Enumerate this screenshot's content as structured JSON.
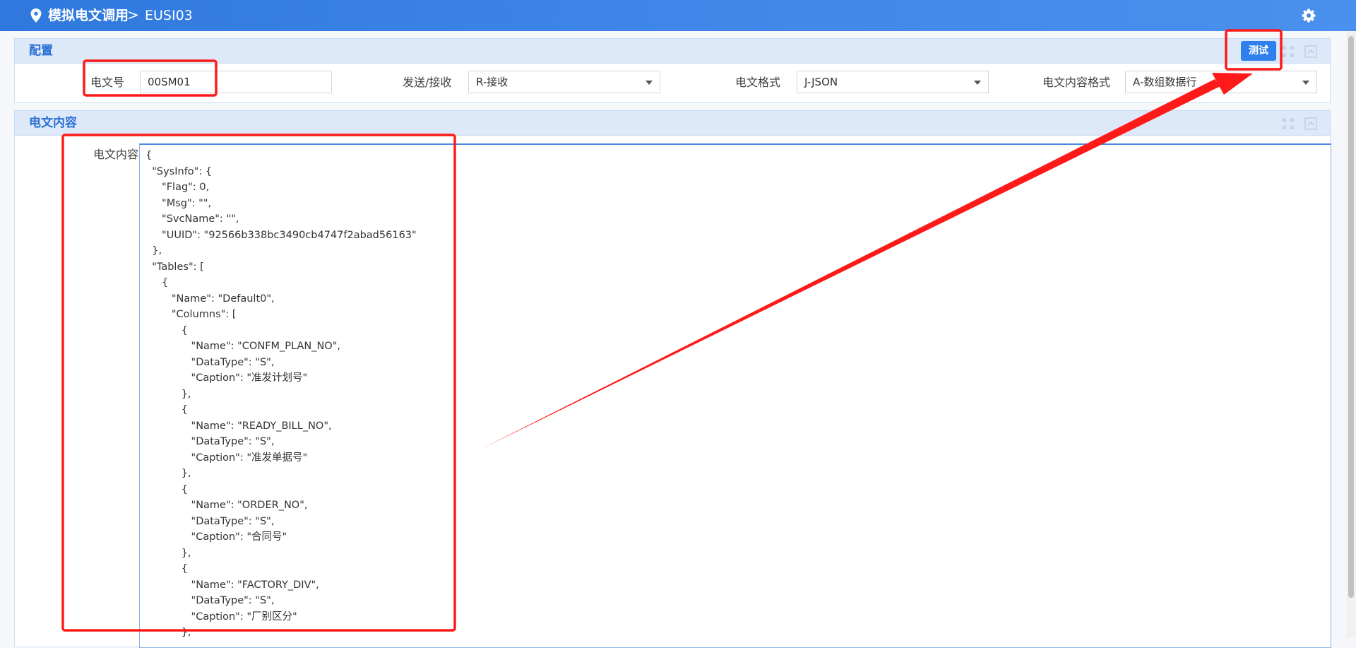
{
  "header": {
    "breadcrumb_module": "模拟电文调用",
    "breadcrumb_separator": ">",
    "breadcrumb_current": "EUSI03"
  },
  "config_panel": {
    "title": "配置",
    "test_button": "测试",
    "fields": {
      "message_no_label": "电文号",
      "message_no_value": "00SM01",
      "direction_label": "发送/接收",
      "direction_value": "R-接收",
      "format_label": "电文格式",
      "format_value": "J-JSON",
      "content_format_label": "电文内容格式",
      "content_format_value": "A-数组数据行"
    }
  },
  "content_panel": {
    "title": "电文内容",
    "field_label": "电文内容",
    "body": "{\n  \"SysInfo\": {\n     \"Flag\": 0,\n     \"Msg\": \"\",\n     \"SvcName\": \"\",\n     \"UUID\": \"92566b338bc3490cb4747f2abad56163\"\n  },\n  \"Tables\": [\n     {\n        \"Name\": \"Default0\",\n        \"Columns\": [\n           {\n              \"Name\": \"CONFM_PLAN_NO\",\n              \"DataType\": \"S\",\n              \"Caption\": \"准发计划号\"\n           },\n           {\n              \"Name\": \"READY_BILL_NO\",\n              \"DataType\": \"S\",\n              \"Caption\": \"准发单据号\"\n           },\n           {\n              \"Name\": \"ORDER_NO\",\n              \"DataType\": \"S\",\n              \"Caption\": \"合同号\"\n           },\n           {\n              \"Name\": \"FACTORY_DIV\",\n              \"DataType\": \"S\",\n              \"Caption\": \"厂别区分\"\n           },"
  },
  "colors": {
    "header_bg": "#3a82e4",
    "panel_head_bg": "#dde9f9",
    "accent": "#2f80ed",
    "annotation_red": "#ff1a1a"
  },
  "icons": {
    "location": "map-pin-icon",
    "settings": "gear-icon",
    "expand": "fullscreen-icon",
    "collapse": "collapse-up-icon"
  }
}
